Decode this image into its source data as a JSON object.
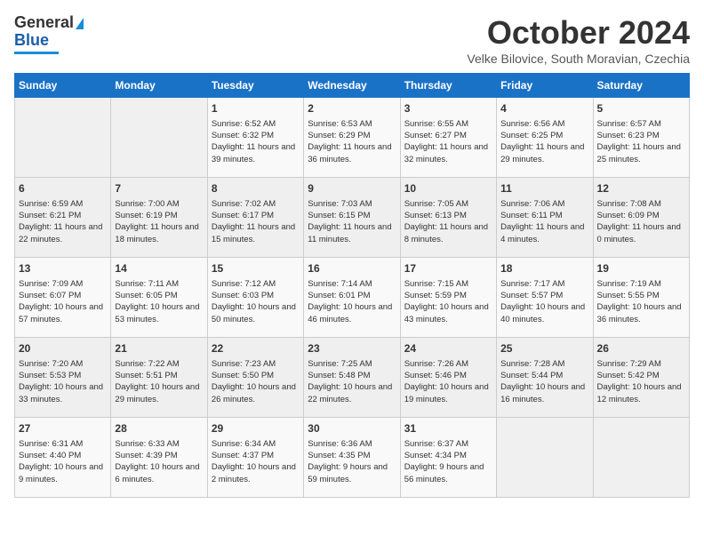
{
  "header": {
    "logo_line1": "General",
    "logo_line2": "Blue",
    "month": "October 2024",
    "location": "Velke Bilovice, South Moravian, Czechia"
  },
  "weekdays": [
    "Sunday",
    "Monday",
    "Tuesday",
    "Wednesday",
    "Thursday",
    "Friday",
    "Saturday"
  ],
  "weeks": [
    [
      {
        "day": "",
        "info": ""
      },
      {
        "day": "",
        "info": ""
      },
      {
        "day": "1",
        "info": "Sunrise: 6:52 AM\nSunset: 6:32 PM\nDaylight: 11 hours and 39 minutes."
      },
      {
        "day": "2",
        "info": "Sunrise: 6:53 AM\nSunset: 6:29 PM\nDaylight: 11 hours and 36 minutes."
      },
      {
        "day": "3",
        "info": "Sunrise: 6:55 AM\nSunset: 6:27 PM\nDaylight: 11 hours and 32 minutes."
      },
      {
        "day": "4",
        "info": "Sunrise: 6:56 AM\nSunset: 6:25 PM\nDaylight: 11 hours and 29 minutes."
      },
      {
        "day": "5",
        "info": "Sunrise: 6:57 AM\nSunset: 6:23 PM\nDaylight: 11 hours and 25 minutes."
      }
    ],
    [
      {
        "day": "6",
        "info": "Sunrise: 6:59 AM\nSunset: 6:21 PM\nDaylight: 11 hours and 22 minutes."
      },
      {
        "day": "7",
        "info": "Sunrise: 7:00 AM\nSunset: 6:19 PM\nDaylight: 11 hours and 18 minutes."
      },
      {
        "day": "8",
        "info": "Sunrise: 7:02 AM\nSunset: 6:17 PM\nDaylight: 11 hours and 15 minutes."
      },
      {
        "day": "9",
        "info": "Sunrise: 7:03 AM\nSunset: 6:15 PM\nDaylight: 11 hours and 11 minutes."
      },
      {
        "day": "10",
        "info": "Sunrise: 7:05 AM\nSunset: 6:13 PM\nDaylight: 11 hours and 8 minutes."
      },
      {
        "day": "11",
        "info": "Sunrise: 7:06 AM\nSunset: 6:11 PM\nDaylight: 11 hours and 4 minutes."
      },
      {
        "day": "12",
        "info": "Sunrise: 7:08 AM\nSunset: 6:09 PM\nDaylight: 11 hours and 0 minutes."
      }
    ],
    [
      {
        "day": "13",
        "info": "Sunrise: 7:09 AM\nSunset: 6:07 PM\nDaylight: 10 hours and 57 minutes."
      },
      {
        "day": "14",
        "info": "Sunrise: 7:11 AM\nSunset: 6:05 PM\nDaylight: 10 hours and 53 minutes."
      },
      {
        "day": "15",
        "info": "Sunrise: 7:12 AM\nSunset: 6:03 PM\nDaylight: 10 hours and 50 minutes."
      },
      {
        "day": "16",
        "info": "Sunrise: 7:14 AM\nSunset: 6:01 PM\nDaylight: 10 hours and 46 minutes."
      },
      {
        "day": "17",
        "info": "Sunrise: 7:15 AM\nSunset: 5:59 PM\nDaylight: 10 hours and 43 minutes."
      },
      {
        "day": "18",
        "info": "Sunrise: 7:17 AM\nSunset: 5:57 PM\nDaylight: 10 hours and 40 minutes."
      },
      {
        "day": "19",
        "info": "Sunrise: 7:19 AM\nSunset: 5:55 PM\nDaylight: 10 hours and 36 minutes."
      }
    ],
    [
      {
        "day": "20",
        "info": "Sunrise: 7:20 AM\nSunset: 5:53 PM\nDaylight: 10 hours and 33 minutes."
      },
      {
        "day": "21",
        "info": "Sunrise: 7:22 AM\nSunset: 5:51 PM\nDaylight: 10 hours and 29 minutes."
      },
      {
        "day": "22",
        "info": "Sunrise: 7:23 AM\nSunset: 5:50 PM\nDaylight: 10 hours and 26 minutes."
      },
      {
        "day": "23",
        "info": "Sunrise: 7:25 AM\nSunset: 5:48 PM\nDaylight: 10 hours and 22 minutes."
      },
      {
        "day": "24",
        "info": "Sunrise: 7:26 AM\nSunset: 5:46 PM\nDaylight: 10 hours and 19 minutes."
      },
      {
        "day": "25",
        "info": "Sunrise: 7:28 AM\nSunset: 5:44 PM\nDaylight: 10 hours and 16 minutes."
      },
      {
        "day": "26",
        "info": "Sunrise: 7:29 AM\nSunset: 5:42 PM\nDaylight: 10 hours and 12 minutes."
      }
    ],
    [
      {
        "day": "27",
        "info": "Sunrise: 6:31 AM\nSunset: 4:40 PM\nDaylight: 10 hours and 9 minutes."
      },
      {
        "day": "28",
        "info": "Sunrise: 6:33 AM\nSunset: 4:39 PM\nDaylight: 10 hours and 6 minutes."
      },
      {
        "day": "29",
        "info": "Sunrise: 6:34 AM\nSunset: 4:37 PM\nDaylight: 10 hours and 2 minutes."
      },
      {
        "day": "30",
        "info": "Sunrise: 6:36 AM\nSunset: 4:35 PM\nDaylight: 9 hours and 59 minutes."
      },
      {
        "day": "31",
        "info": "Sunrise: 6:37 AM\nSunset: 4:34 PM\nDaylight: 9 hours and 56 minutes."
      },
      {
        "day": "",
        "info": ""
      },
      {
        "day": "",
        "info": ""
      }
    ]
  ]
}
